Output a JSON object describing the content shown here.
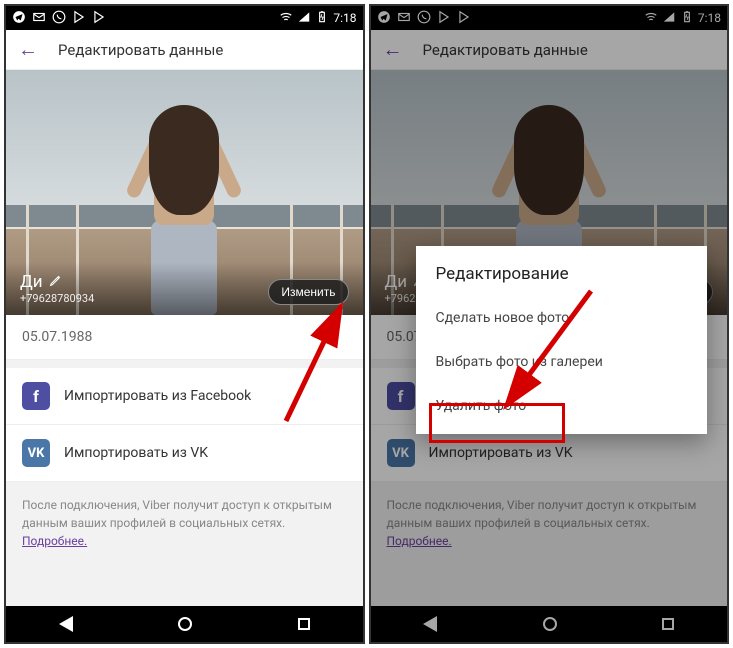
{
  "status": {
    "time": "7:18"
  },
  "appbar": {
    "title": "Редактировать данные"
  },
  "profile": {
    "name": "Ди",
    "phone": "+79628780934",
    "change_label": "Изменить",
    "dob": "05.07.1988"
  },
  "import": {
    "fb": "Импортировать из Facebook",
    "vk": "Импортировать из VK"
  },
  "footer": {
    "note": "После подключения, Viber получит доступ к открытым данным ваших профилей в социальных сетях.",
    "link": "Подробнее."
  },
  "dialog": {
    "title": "Редактирование",
    "items": {
      "take": "Сделать новое фото",
      "gallery": "Выбрать фото из галереи",
      "delete": "Удалить фото"
    }
  }
}
